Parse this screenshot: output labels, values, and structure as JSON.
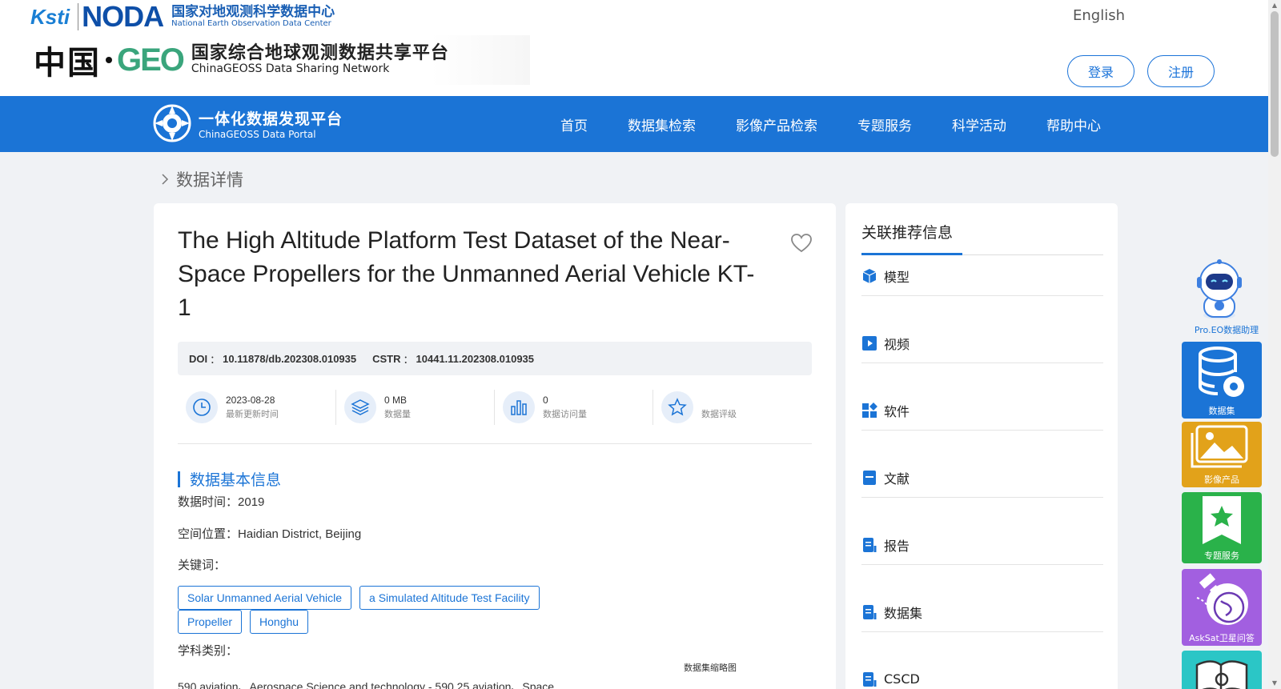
{
  "header": {
    "cnic_logo": "Ksti",
    "noda_logo": "NODA",
    "noda_cn": "国家对地观测科学数据中心",
    "noda_en": "National Earth Observation Data Center",
    "china_cn": "中国",
    "geo_logo": "GEO",
    "platform_cn": "国家综合地球观测数据共享平台",
    "platform_en": "ChinaGEOSS Data Sharing Network",
    "language_link": "English",
    "login_label": "登录",
    "register_label": "注册"
  },
  "navbar": {
    "portal_cn": "一体化数据发现平台",
    "portal_en": "ChinaGEOSS Data Portal",
    "items": [
      {
        "label": "首页"
      },
      {
        "label": "数据集检索"
      },
      {
        "label": "影像产品检索"
      },
      {
        "label": "专题服务"
      },
      {
        "label": "科学活动"
      },
      {
        "label": "帮助中心"
      }
    ]
  },
  "breadcrumb": {
    "current": "数据详情"
  },
  "dataset": {
    "title": "The High Altitude Platform Test Dataset of the Near-Space Propellers for the Unmanned Aerial Vehicle KT-1",
    "doi_label": "DOI",
    "doi_value": "10.11878/db.202308.010935",
    "cstr_label": "CSTR",
    "cstr_value": "10441.11.202308.010935",
    "colon": "：",
    "stats": [
      {
        "value": "2023-08-28",
        "label": "最新更新时间",
        "icon": "clock-icon"
      },
      {
        "value": "0 MB",
        "label": "数据量",
        "icon": "layers-icon"
      },
      {
        "value": "0",
        "label": "数据访问量",
        "icon": "bar-chart-icon"
      },
      {
        "value": "",
        "label": "数据评级",
        "icon": "star-icon"
      }
    ],
    "section_title": "数据基本信息",
    "data_time_label": "数据时间：",
    "data_time_value": "2019",
    "location_label": "空间位置：",
    "location_value": "Haidian District, Beijing",
    "keywords_label": "关键词：",
    "keywords": [
      "Solar Unmanned Aerial Vehicle",
      "a Simulated Altitude Test Facility",
      "Propeller",
      "Honghu"
    ],
    "subject_label": "学科类别：",
    "subject_value": "590 aviation、Aerospace Science and technology - 590.25 aviation、Space",
    "thumbnail_label": "数据集缩略图"
  },
  "related": {
    "title": "关联推荐信息",
    "items": [
      {
        "label": "模型",
        "icon": "cube-icon"
      },
      {
        "label": "视频",
        "icon": "play-icon"
      },
      {
        "label": "软件",
        "icon": "apps-icon"
      },
      {
        "label": "文献",
        "icon": "document-icon"
      },
      {
        "label": "报告",
        "icon": "report-icon"
      },
      {
        "label": "数据集",
        "icon": "dataset-icon"
      },
      {
        "label": "CSCD",
        "icon": "cscd-icon"
      }
    ]
  },
  "side_tools": {
    "assistant_label": "Pro.EO数据助理",
    "dataset_label": "数据集",
    "image_label": "影像产品",
    "topic_label": "专题服务",
    "asksat_label": "AskSat卫星问答"
  },
  "colors": {
    "primary": "#1b74d6",
    "image_btn": "#e2a21a",
    "topic_btn": "#2ab24a",
    "asksat_btn": "#a25fe0",
    "more_btn": "#2bc6c6"
  }
}
